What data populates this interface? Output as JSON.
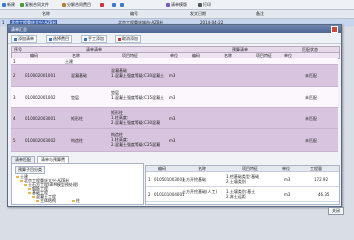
{
  "toolbar": {
    "buttons": [
      {
        "label": "新建",
        "color": "#3b7ad1"
      },
      {
        "label": "复制合同文件",
        "color": "#4a9c3b"
      },
      {
        "label": "分解合同费目",
        "color": "#c27a2a"
      },
      {
        "label": "",
        "color": "#c33"
      },
      {
        "label": "",
        "color": "#3b7ad1"
      },
      {
        "label": "",
        "color": "#3b7ad1"
      },
      {
        "label": "清单模版",
        "color": "#7a5ab8"
      },
      {
        "label": "打印",
        "color": "#555"
      }
    ]
  },
  "bg_grid": {
    "headers": [
      "名称",
      "编号",
      "发文日期",
      "备注"
    ],
    "rows": [
      {
        "num": "1",
        "name": "北京工程重庆大兴-AZBH",
        "code": "北京工程重庆城市-AZBH",
        "date": "2014-04-22",
        "note": ""
      }
    ],
    "extra_row_num": "2"
  },
  "dialog": {
    "title": "清单汇总",
    "toolbar": [
      "添加清单",
      "选择费目",
      "手工添加",
      "取消添加"
    ],
    "header1": [
      "序号",
      "清单清单",
      "预算清单",
      "匹配状态"
    ],
    "header2": [
      "编码",
      "名称",
      "项目特征",
      "单位",
      "编码",
      "名称",
      "项目特征",
      "单位"
    ],
    "rows": [
      {
        "seq": "1",
        "code": "",
        "name": "土建",
        "feature": "",
        "unit": "",
        "status": "",
        "type": "light"
      },
      {
        "seq": "2",
        "code": "010002001001",
        "name": "混凝基础",
        "feature": "混凝基础\n1.混凝土强度等级:C30混凝土",
        "unit": "m3",
        "status": "未匹配",
        "type": "dark"
      },
      {
        "seq": "3",
        "code": "010002001002",
        "name": "垫层",
        "feature": "垫层\n1.混凝土强度等级:C15混凝土",
        "unit": "m3",
        "status": "未匹配",
        "type": "light"
      },
      {
        "seq": "4",
        "code": "010002003001",
        "name": "矩形柱",
        "feature": "矩形柱\n1.柱高度:\n2.混凝土强度等级:C30混凝",
        "unit": "m3",
        "status": "未匹配",
        "type": "dark"
      },
      {
        "seq": "5",
        "code": "010002003002",
        "name": "构造柱",
        "feature": "构造柱\n1.柱高度:\n2.混凝土强度等级:C25混凝",
        "unit": "m3",
        "status": "未匹配",
        "type": "dark"
      }
    ],
    "tabs": [
      "清单匹配",
      "清单与预算费"
    ],
    "tree": {
      "title": "预算子目分类",
      "items": [
        {
          "label": "土建",
          "indent": 0
        },
        {
          "label": "北京工程重庆大兴-AZBH",
          "indent": 1
        },
        {
          "label": "土石方工程(BIM模型预处理)",
          "indent": 2
        },
        {
          "label": "钢筋工程",
          "indent": 3
        },
        {
          "label": "基础工程",
          "indent": 3
        },
        {
          "label": "混凝土工程",
          "indent": 4
        },
        {
          "label": "主体结构",
          "indent": 5
        },
        {
          "label": "柱",
          "indent": 5
        }
      ]
    },
    "right_grid": {
      "headers": [
        "编码",
        "名称",
        "项目特征",
        "单位",
        "工程量"
      ],
      "rows": [
        {
          "num": "1",
          "code": "010501003001",
          "name": "土方开挖基础",
          "feature": "1.挖基础类型:基础\n2.土壤类别",
          "unit": "m3",
          "qty": "172.92"
        },
        {
          "num": "2",
          "code": "010101004001",
          "name": "土方开挖基础(人工)",
          "feature": "1.土壤类别:基土\n2.弃土运距",
          "unit": "m3",
          "qty": "46.35"
        }
      ]
    },
    "close_label": "关闭"
  }
}
